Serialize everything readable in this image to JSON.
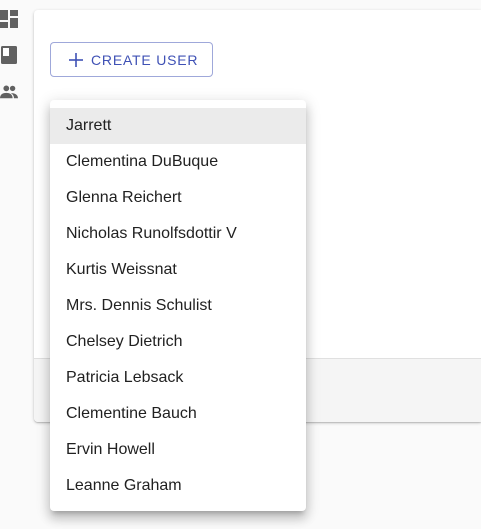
{
  "sidebar": {
    "items": [
      {
        "icon": "dashboard-icon"
      },
      {
        "icon": "book-icon"
      },
      {
        "icon": "people-icon"
      }
    ]
  },
  "toolbar": {
    "create_label": "CREATE USER",
    "create_icon": "plus-icon"
  },
  "menu": {
    "selected_index": 0,
    "items": [
      "Jarrett",
      "Clementina DuBuque",
      "Glenna Reichert",
      "Nicholas Runolfsdottir V",
      "Kurtis Weissnat",
      "Mrs. Dennis Schulist",
      "Chelsey Dietrich",
      "Patricia Lebsack",
      "Clementine Bauch",
      "Ervin Howell",
      "Leanne Graham"
    ]
  },
  "colors": {
    "accent": "#3f51b5",
    "icon": "#616161",
    "selected_bg": "#ebebeb"
  }
}
